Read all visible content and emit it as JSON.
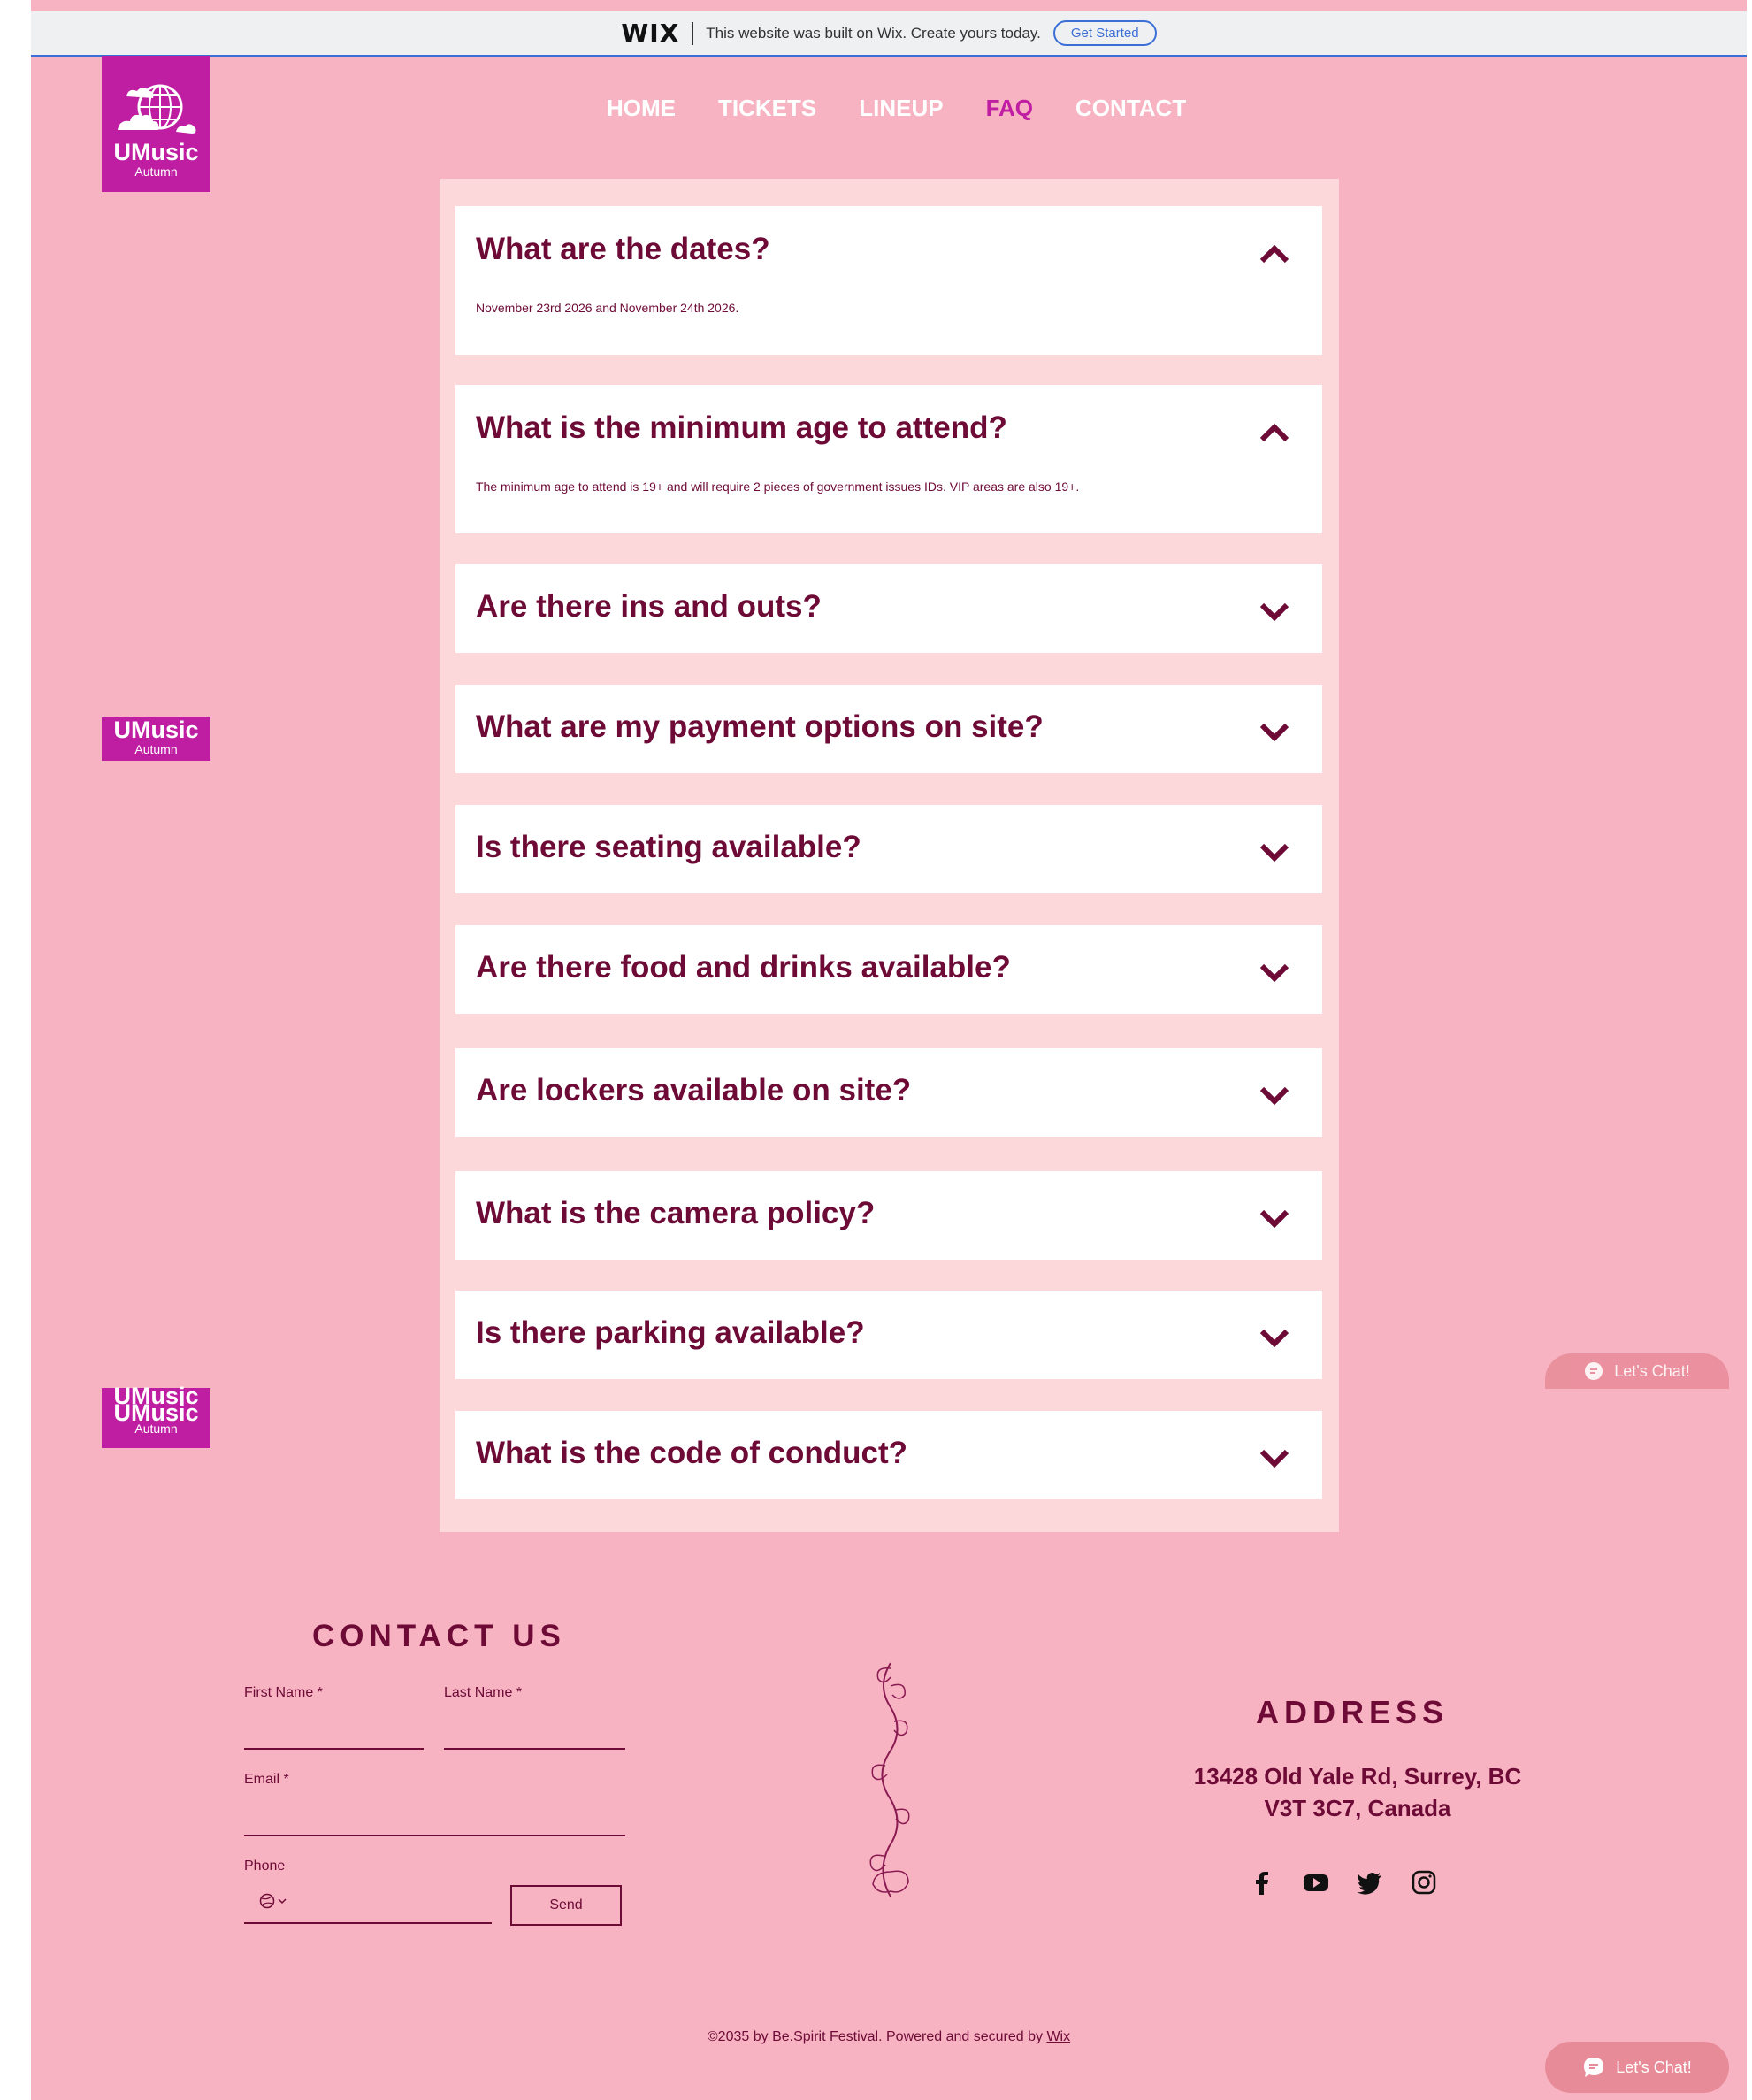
{
  "wix_banner": {
    "logo": "WIX",
    "message": "This website was built on Wix. Create yours today.",
    "button": "Get Started",
    "accent": "#3b6fd6"
  },
  "logo": {
    "name": "UMusic",
    "subtitle": "Autumn",
    "bg_color": "#bf1ea3"
  },
  "nav": {
    "items": [
      {
        "label": "HOME"
      },
      {
        "label": "TICKETS"
      },
      {
        "label": "LINEUP"
      },
      {
        "label": "FAQ"
      },
      {
        "label": "CONTACT"
      }
    ],
    "active": "FAQ"
  },
  "faq": {
    "items": [
      {
        "question": "What are the dates?",
        "answer": "November 23rd 2026 and November 24th 2026.",
        "expanded": true,
        "icon": "chevron-up-icon"
      },
      {
        "question": "What is the minimum age to attend?",
        "answer": "The minimum age to attend is 19+ and will require 2 pieces of government issues IDs. VIP areas are also 19+.",
        "expanded": true,
        "icon": "chevron-up-icon"
      },
      {
        "question": "Are there ins and outs?",
        "expanded": false,
        "icon": "chevron-down-icon"
      },
      {
        "question": "What are my payment options on site?",
        "expanded": false,
        "icon": "chevron-down-icon"
      },
      {
        "question": "Is there seating available?",
        "expanded": false,
        "icon": "chevron-down-icon"
      },
      {
        "question": "Are there food and drinks available?",
        "expanded": false,
        "icon": "chevron-down-icon"
      },
      {
        "question": "Are lockers available on site?",
        "expanded": false,
        "icon": "chevron-down-icon"
      },
      {
        "question": "What is the camera policy?",
        "expanded": false,
        "icon": "chevron-down-icon"
      },
      {
        "question": "Is there parking available?",
        "expanded": false,
        "icon": "chevron-down-icon"
      },
      {
        "question": "What is the code of conduct?",
        "expanded": false,
        "icon": "chevron-down-icon"
      }
    ]
  },
  "contact": {
    "title": "CONTACT US",
    "first_name_label": "First Name *",
    "last_name_label": "Last Name *",
    "email_label": "Email *",
    "phone_label": "Phone",
    "send_label": "Send"
  },
  "address": {
    "title": "ADDRESS",
    "line1": "13428 Old Yale Rd, Surrey, BC",
    "line2": "V3T 3C7, Canada",
    "social_icons": [
      "facebook-icon",
      "youtube-icon",
      "twitter-icon",
      "instagram-icon"
    ]
  },
  "footer": {
    "copyright": "©2035 by Be.Spirit Festival. Powered and secured by ",
    "link": "Wix"
  },
  "chat": {
    "label": "Let's Chat!"
  },
  "colors": {
    "page_bg": "#f7b3c2",
    "panel_bg": "#fdd8da",
    "text_dark": "#6d0a36",
    "brand": "#bf1ea3",
    "chat_bg": "#e88b98"
  }
}
